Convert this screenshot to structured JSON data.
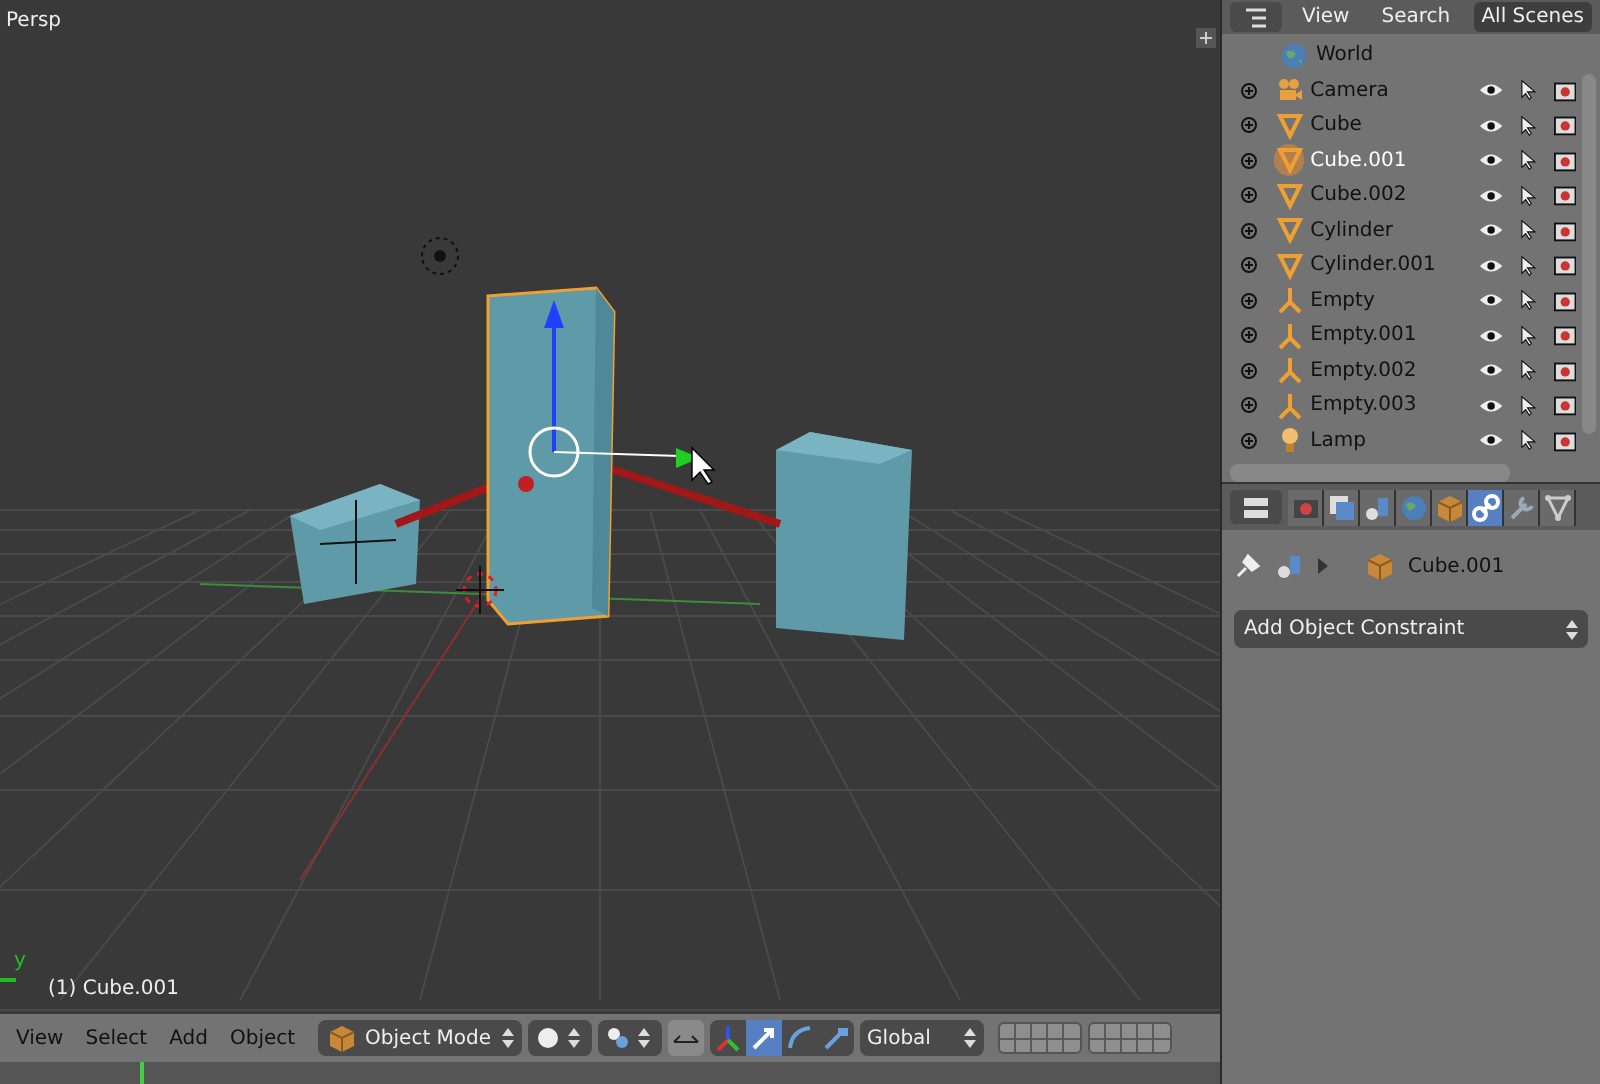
{
  "viewport": {
    "view_name": "Persp",
    "object_label": "(1) Cube.001",
    "axis_label": "y"
  },
  "header": {
    "menus": [
      "View",
      "Select",
      "Add",
      "Object"
    ],
    "mode": "Object Mode",
    "orientation": "Global",
    "manipulators": [
      {
        "kind": "translate",
        "selected": true
      },
      {
        "kind": "rotate",
        "selected": false
      },
      {
        "kind": "scale",
        "selected": false
      }
    ]
  },
  "outliner": {
    "menus": [
      "View",
      "Search"
    ],
    "scene_filter": "All Scenes",
    "items": [
      {
        "name": "World",
        "kind": "world",
        "selected": false
      },
      {
        "name": "Camera",
        "kind": "camera",
        "selected": false
      },
      {
        "name": "Cube",
        "kind": "mesh",
        "selected": false
      },
      {
        "name": "Cube.001",
        "kind": "mesh",
        "selected": true
      },
      {
        "name": "Cube.002",
        "kind": "mesh",
        "selected": false
      },
      {
        "name": "Cylinder",
        "kind": "mesh",
        "selected": false
      },
      {
        "name": "Cylinder.001",
        "kind": "mesh",
        "selected": false
      },
      {
        "name": "Empty",
        "kind": "empty",
        "selected": false
      },
      {
        "name": "Empty.001",
        "kind": "empty",
        "selected": false
      },
      {
        "name": "Empty.002",
        "kind": "empty",
        "selected": false
      },
      {
        "name": "Empty.003",
        "kind": "empty",
        "selected": false
      },
      {
        "name": "Lamp",
        "kind": "lamp",
        "selected": false
      }
    ]
  },
  "properties": {
    "tabs": [
      {
        "kind": "render",
        "selected": false
      },
      {
        "kind": "layers",
        "selected": false
      },
      {
        "kind": "scene",
        "selected": false
      },
      {
        "kind": "world",
        "selected": false
      },
      {
        "kind": "object",
        "selected": false
      },
      {
        "kind": "constraints",
        "selected": true
      },
      {
        "kind": "modifiers",
        "selected": false
      },
      {
        "kind": "data",
        "selected": false
      }
    ],
    "breadcrumb": "Cube.001",
    "constraint_menu": "Add Object Constraint"
  }
}
